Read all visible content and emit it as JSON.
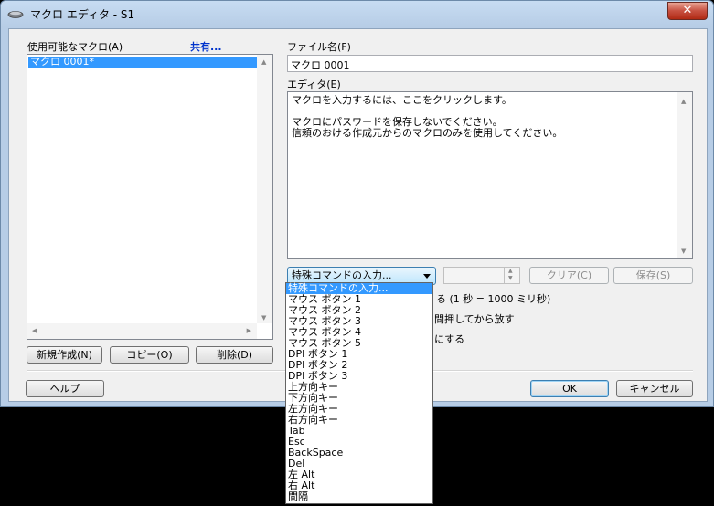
{
  "window": {
    "title": "マクロ エディタ - S1",
    "close_label": "✕"
  },
  "left": {
    "macros_label": "使用可能なマクロ(A)",
    "share_link": "共有...",
    "macros": [
      "マクロ 0001*"
    ],
    "new_button": "新規作成(N)",
    "copy_button": "コピー(O)",
    "delete_button": "削除(D)"
  },
  "right": {
    "filename_label": "ファイル名(F)",
    "filename_value": "マクロ 0001",
    "editor_label": "エディタ(E)",
    "editor_lines": [
      "マクロを入力するには、ここをクリックします。",
      "",
      "マクロにパスワードを保存しないでください。",
      "信頼のおける作成元からのマクロのみを使用してください。"
    ],
    "special_command_selected": "特殊コマンドの入力...",
    "clear_button": "クリア(C)",
    "save_button": "保存(S)",
    "partial_text_1": "る (1 秒 = 1000 ミリ秒)",
    "partial_text_2": "間押してから放す",
    "partial_text_3": "にする"
  },
  "footer": {
    "help_button": "ヘルプ",
    "ok_button": "OK",
    "cancel_button": "キャンセル"
  },
  "dropdown_options": [
    "特殊コマンドの入力...",
    "マウス ボタン 1",
    "マウス ボタン 2",
    "マウス ボタン 3",
    "マウス ボタン 4",
    "マウス ボタン 5",
    "DPI ボタン 1",
    "DPI ボタン 2",
    "DPI ボタン 3",
    "上方向キー",
    "下方向キー",
    "左方向キー",
    "右方向キー",
    "Tab",
    "Esc",
    "BackSpace",
    "Del",
    "左 Alt",
    "右 Alt",
    "間隔"
  ],
  "colors": {
    "selection": "#3399ff",
    "link": "#0033cc",
    "close_button": "#c75040"
  }
}
